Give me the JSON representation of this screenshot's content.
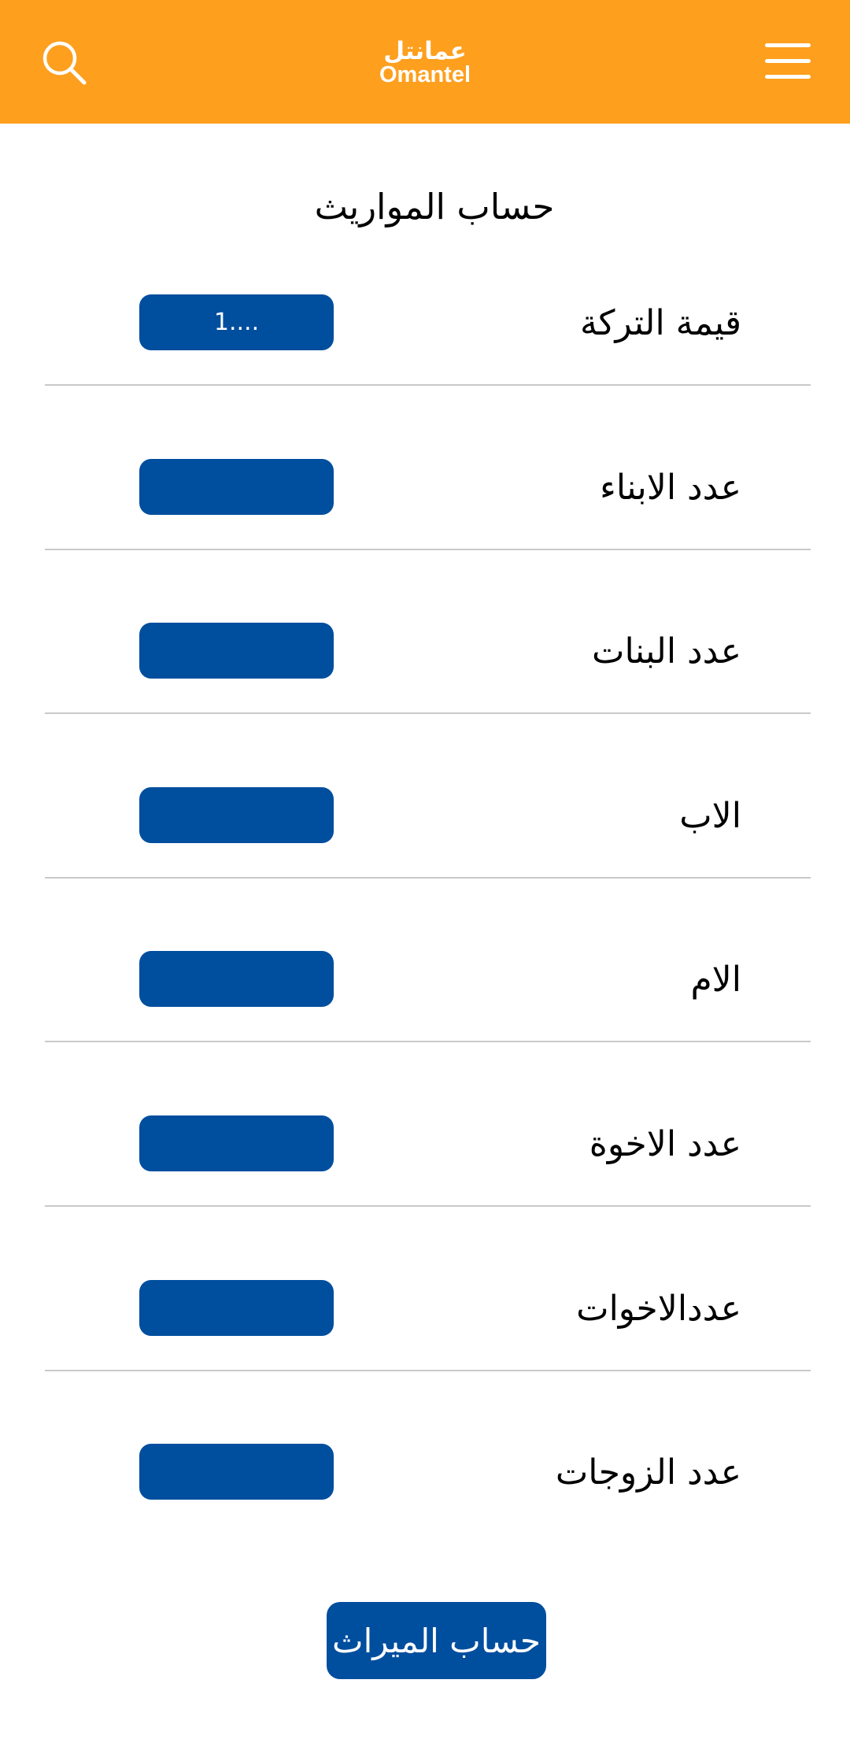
{
  "header": {
    "logo_arabic": "عمانتل",
    "logo_english": "Omantel",
    "background_color": "#fe9f1e",
    "search_icon": "search-icon",
    "menu_icon": "hamburger-menu-icon"
  },
  "page_title": "حساب المواريث",
  "form": {
    "fields": [
      {
        "label": "قيمة التركة",
        "value": "1...."
      },
      {
        "label": "عدد الابناء",
        "value": ""
      },
      {
        "label": "عدد البنات",
        "value": ""
      },
      {
        "label": "الاب",
        "value": ""
      },
      {
        "label": "الام",
        "value": ""
      },
      {
        "label": "عدد الاخوة",
        "value": ""
      },
      {
        "label": "عددالاخوات",
        "value": ""
      },
      {
        "label": "عدد الزوجات",
        "value": ""
      }
    ],
    "input_color": "#004e9e",
    "submit_label": "حساب الميراث"
  }
}
